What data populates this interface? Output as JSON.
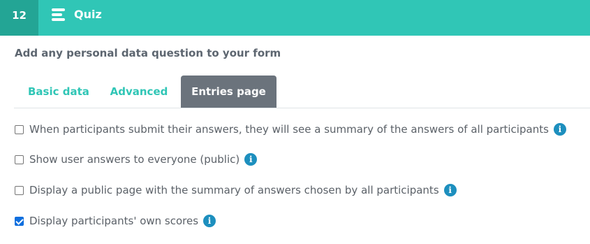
{
  "header": {
    "step_number": "12",
    "title": "Quiz",
    "menu_icon": "hamburger-menu-icon",
    "bg_color": "#30c6b6",
    "step_bg_color": "#23a595"
  },
  "section": {
    "subtitle": "Add any personal data question to your form"
  },
  "tabs": [
    {
      "label": "Basic data",
      "active": false
    },
    {
      "label": "Advanced",
      "active": false
    },
    {
      "label": "Entries page",
      "active": true
    }
  ],
  "options": [
    {
      "label": "When participants submit their answers, they will see a summary of the answers of all participants",
      "checked": false,
      "info_icon": "info-icon"
    },
    {
      "label": "Show user answers to everyone (public)",
      "checked": false,
      "info_icon": "info-icon"
    },
    {
      "label": "Display a public page with the summary of answers chosen by all participants",
      "checked": false,
      "info_icon": "info-icon"
    },
    {
      "label": "Display participants' own scores",
      "checked": true,
      "info_icon": "info-icon"
    }
  ]
}
